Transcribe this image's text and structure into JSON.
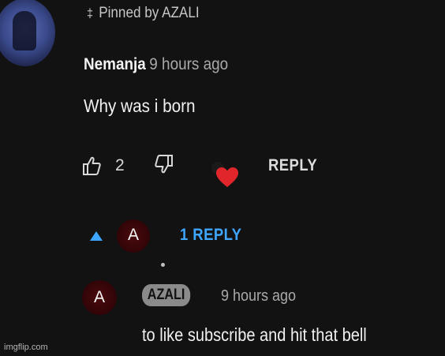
{
  "comment": {
    "pinned_label": "Pinned by AZALI",
    "author": "Nemanja",
    "time": "9 hours ago",
    "text": "Why was i born",
    "like_count": "2",
    "reply_label": "REPLY"
  },
  "replies": {
    "toggle_label": "1 REPLY",
    "avatar_letter": "A",
    "item": {
      "avatar_letter": "A",
      "author": "AZALI",
      "time": "9 hours ago",
      "text": "to like subscribe and hit that bell"
    }
  },
  "colors": {
    "background": "#121212",
    "link_blue": "#3ea6ff",
    "heart_red": "#e0262b",
    "avatar_red": "#4a0a0d"
  },
  "icons": [
    "pin-icon",
    "thumbs-up-icon",
    "thumbs-down-icon",
    "creator-heart-icon",
    "expand-up-icon"
  ],
  "watermark": "imgflip.com"
}
